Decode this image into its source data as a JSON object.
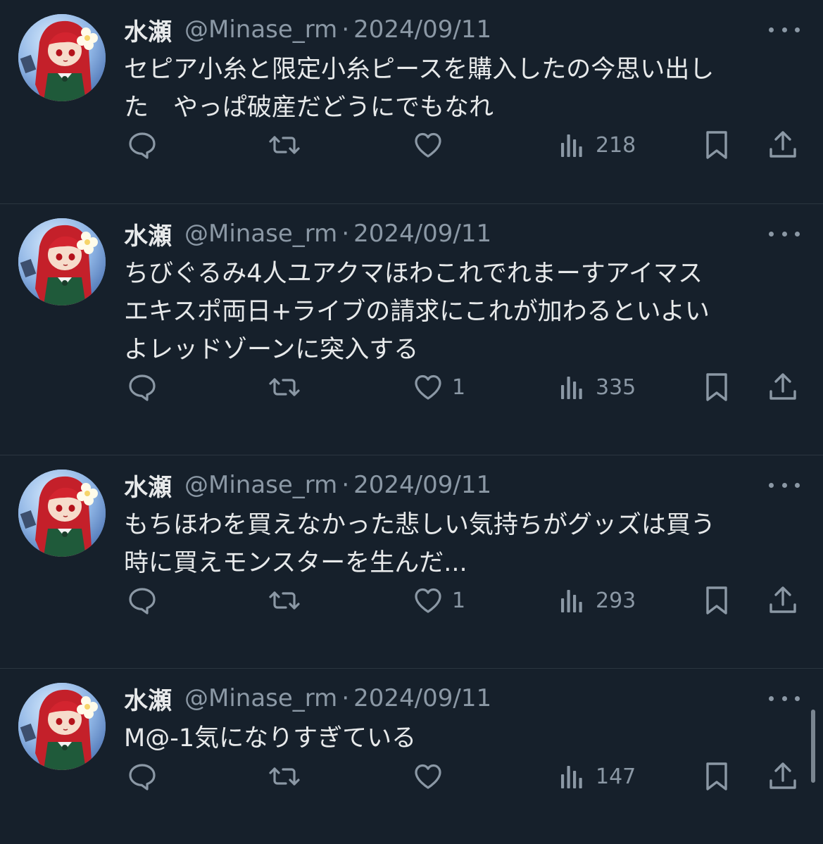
{
  "tweets": [
    {
      "name": "水瀬",
      "handle": "@Minase_rm",
      "sep": "·",
      "date": "2024/09/11",
      "text": "セピア小糸と限定小糸ピースを購入したの今思い出し\nた　やっぱ破産だどうにでもなれ",
      "likes": "",
      "views": "218"
    },
    {
      "name": "水瀬",
      "handle": "@Minase_rm",
      "sep": "·",
      "date": "2024/09/11",
      "text": "ちびぐるみ4人ユアクマほわこれでれまーすアイマス\nエキスポ両日+ライブの請求にこれが加わるといよい\nよレッドゾーンに突入する",
      "likes": "1",
      "views": "335"
    },
    {
      "name": "水瀬",
      "handle": "@Minase_rm",
      "sep": "·",
      "date": "2024/09/11",
      "text": "もちほわを買えなかった悲しい気持ちがグッズは買う\n時に買えモンスターを生んだ...",
      "likes": "1",
      "views": "293"
    },
    {
      "name": "水瀬",
      "handle": "@Minase_rm",
      "sep": "·",
      "date": "2024/09/11",
      "text": "M@-1気になりすぎている",
      "likes": "",
      "views": "147"
    }
  ],
  "icons": {
    "reply": "reply-icon",
    "repost": "repost-icon",
    "like": "heart-icon",
    "views": "views-icon",
    "bookmark": "bookmark-icon",
    "share": "share-icon",
    "more": "more-icon"
  },
  "colors": {
    "background": "#16202b",
    "text": "#e7e9ea",
    "muted": "#8b98a5",
    "divider": "#2b3640"
  }
}
